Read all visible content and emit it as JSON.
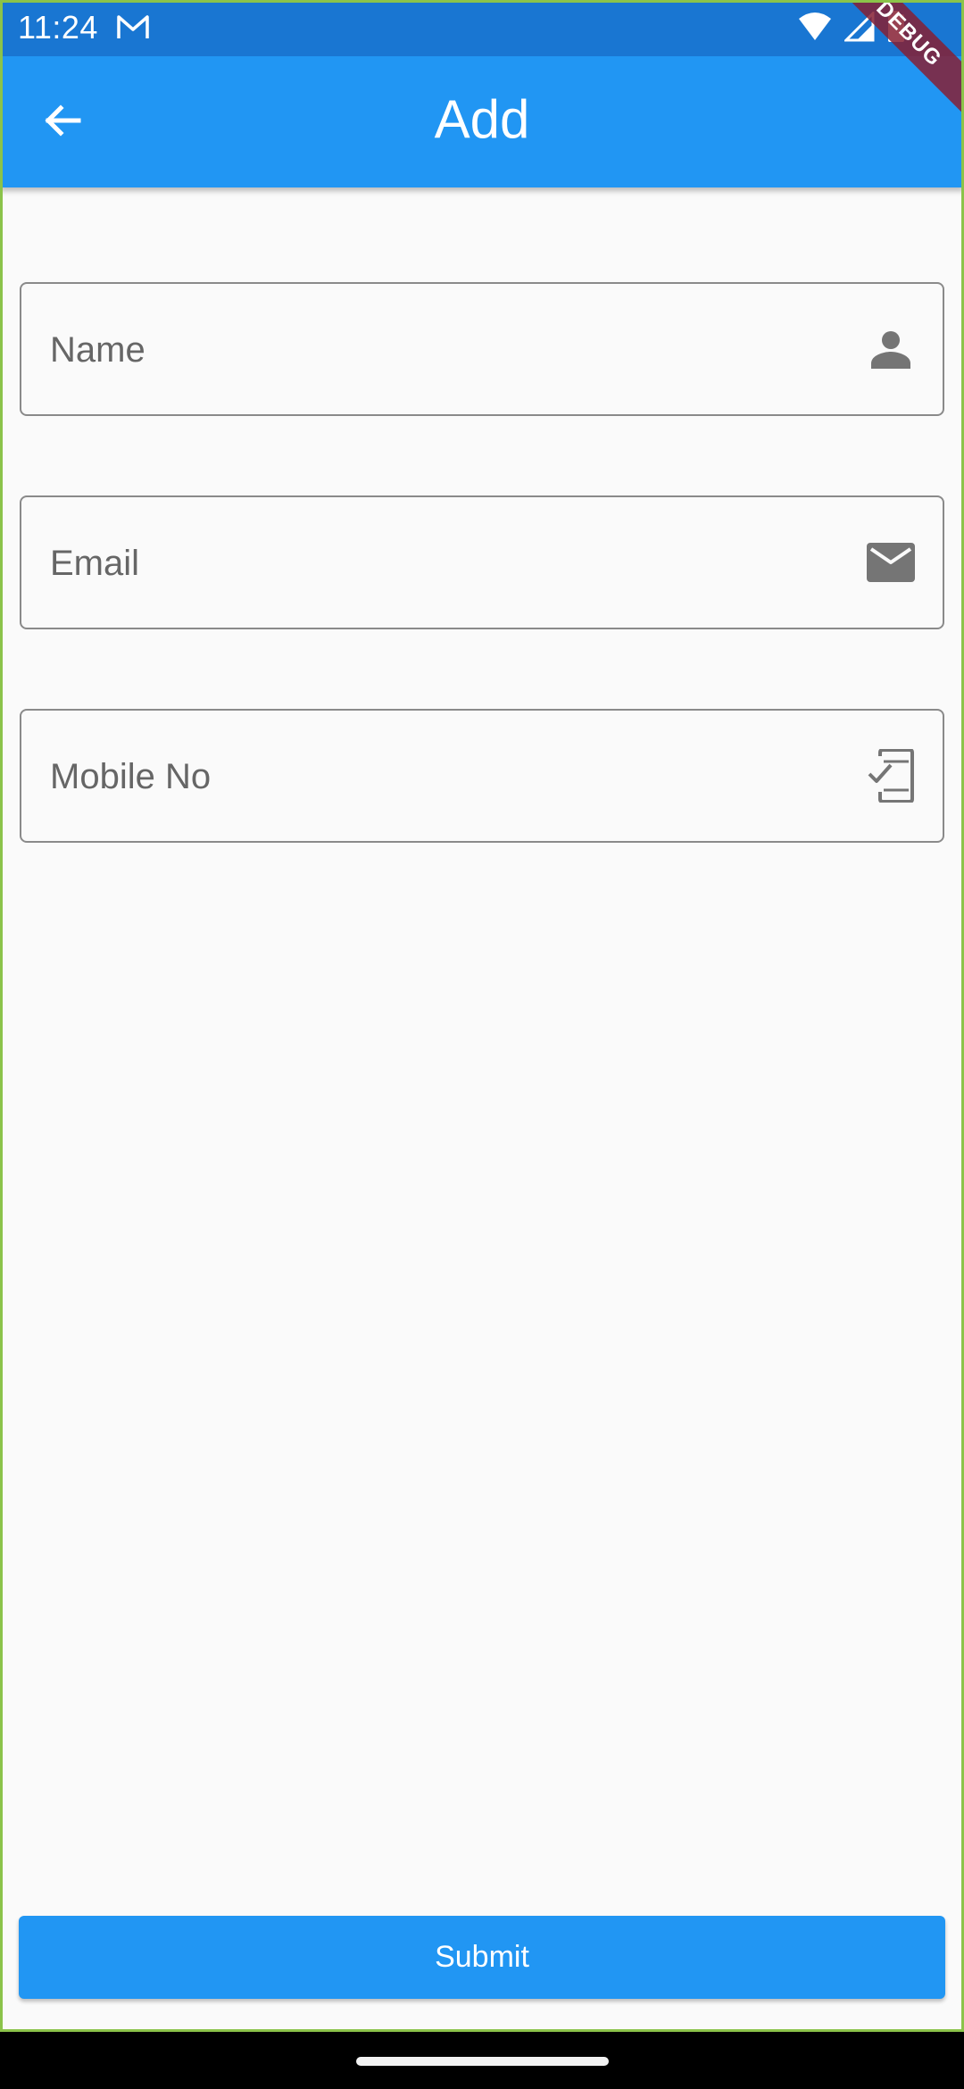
{
  "status_bar": {
    "time": "11:24",
    "notification_icon": "gmail-icon",
    "icons": [
      "wifi-icon",
      "signal-icon",
      "battery-icon"
    ]
  },
  "app_bar": {
    "title": "Add",
    "back_icon": "arrow-back-icon"
  },
  "debug_banner": "DEBUG",
  "form": {
    "name": {
      "placeholder": "Name",
      "value": "",
      "icon": "person-icon"
    },
    "email": {
      "placeholder": "Email",
      "value": "",
      "icon": "mail-icon"
    },
    "mobile": {
      "placeholder": "Mobile No",
      "value": "",
      "icon": "phone-check-icon"
    },
    "submit_label": "Submit"
  },
  "colors": {
    "status_bar": "#1976d2",
    "app_bar": "#2196f3",
    "background": "#fafafa",
    "field_border": "#8a8a8a",
    "icon": "#757575",
    "debug_banner": "#862034"
  }
}
